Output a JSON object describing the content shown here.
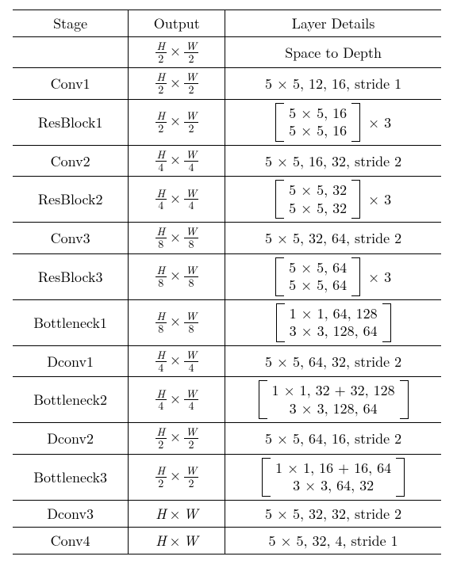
{
  "headers": {
    "c1": "Stage",
    "c2": "Output",
    "c3": "Layer Details"
  },
  "fracspec": {
    "h2": {
      "n": "H",
      "d": "2"
    },
    "w2": {
      "n": "W",
      "d": "2"
    },
    "h4": {
      "n": "H",
      "d": "4"
    },
    "w4": {
      "n": "W",
      "d": "4"
    },
    "h8": {
      "n": "H",
      "d": "8"
    },
    "w8": {
      "n": "W",
      "d": "8"
    }
  },
  "rows": [
    {
      "stage": "",
      "out": "H/2 × W/2",
      "details_type": "text",
      "details": "Space to Depth"
    },
    {
      "stage": "Conv1",
      "out": "H/2 × W/2",
      "details_type": "text",
      "details": "5 × 5, 12, 16, stride 1"
    },
    {
      "stage": "ResBlock1",
      "out": "H/2 × W/2",
      "details_type": "mat3",
      "m1": "5 × 5, 16",
      "m2": "5 × 5, 16",
      "suffix": "× 3"
    },
    {
      "stage": "Conv2",
      "out": "H/4 × W/4",
      "details_type": "text",
      "details": "5 × 5, 16, 32, stride 2"
    },
    {
      "stage": "ResBlock2",
      "out": "H/4 × W/4",
      "details_type": "mat3",
      "m1": "5 × 5, 32",
      "m2": "5 × 5, 32",
      "suffix": "× 3"
    },
    {
      "stage": "Conv3",
      "out": "H/8 × W/8",
      "details_type": "text",
      "details": "5 × 5, 32, 64, stride 2"
    },
    {
      "stage": "ResBlock3",
      "out": "H/8 × W/8",
      "details_type": "mat3",
      "m1": "5 × 5, 64",
      "m2": "5 × 5, 64",
      "suffix": "× 3"
    },
    {
      "stage": "Bottleneck1",
      "out": "H/8 × W/8",
      "details_type": "mat",
      "m1": "1 × 1, 64, 128",
      "m2": "3 × 3, 128, 64"
    },
    {
      "stage": "Dconv1",
      "out": "H/4 × W/4",
      "details_type": "text",
      "details": "5 × 5, 64, 32, stride 2"
    },
    {
      "stage": "Bottleneck2",
      "out": "H/4 × W/4",
      "details_type": "mat",
      "m1": "1 × 1, 32 + 32, 128",
      "m2": "3 × 3, 128, 64"
    },
    {
      "stage": "Dconv2",
      "out": "H/2 × W/2",
      "details_type": "text",
      "details": "5 × 5, 64, 16, stride 2"
    },
    {
      "stage": "Bottleneck3",
      "out": "H/2 × W/2",
      "details_type": "mat",
      "m1": "1 × 1, 16 + 16, 64",
      "m2": "3 × 3, 64, 32"
    },
    {
      "stage": "Dconv3",
      "out": "H × W",
      "details_type": "text",
      "details": "5 × 5, 32, 32, stride 2"
    },
    {
      "stage": "Conv4",
      "out": "H × W",
      "details_type": "text",
      "details": "5 × 5, 32, 4, stride 1"
    }
  ],
  "chart_data": {
    "type": "table",
    "title": "Network architecture stages",
    "columns": [
      "Stage",
      "Output",
      "Layer Details"
    ],
    "rows": [
      [
        "",
        "H/2 × W/2",
        "Space to Depth"
      ],
      [
        "Conv1",
        "H/2 × W/2",
        "5×5, 12, 16, stride 1"
      ],
      [
        "ResBlock1",
        "H/2 × W/2",
        "[5×5,16; 5×5,16] × 3"
      ],
      [
        "Conv2",
        "H/4 × W/4",
        "5×5, 16, 32, stride 2"
      ],
      [
        "ResBlock2",
        "H/4 × W/4",
        "[5×5,32; 5×5,32] × 3"
      ],
      [
        "Conv3",
        "H/8 × W/8",
        "5×5, 32, 64, stride 2"
      ],
      [
        "ResBlock3",
        "H/8 × W/8",
        "[5×5,64; 5×5,64] × 3"
      ],
      [
        "Bottleneck1",
        "H/8 × W/8",
        "[1×1,64,128; 3×3,128,64]"
      ],
      [
        "Dconv1",
        "H/4 × W/4",
        "5×5, 64, 32, stride 2"
      ],
      [
        "Bottleneck2",
        "H/4 × W/4",
        "[1×1,32+32,128; 3×3,128,64]"
      ],
      [
        "Dconv2",
        "H/2 × W/2",
        "5×5, 64, 16, stride 2"
      ],
      [
        "Bottleneck3",
        "H/2 × W/2",
        "[1×1,16+16,64; 3×3,64,32]"
      ],
      [
        "Dconv3",
        "H × W",
        "5×5, 32, 32, stride 2"
      ],
      [
        "Conv4",
        "H × W",
        "5×5, 32, 4, stride 1"
      ]
    ]
  }
}
